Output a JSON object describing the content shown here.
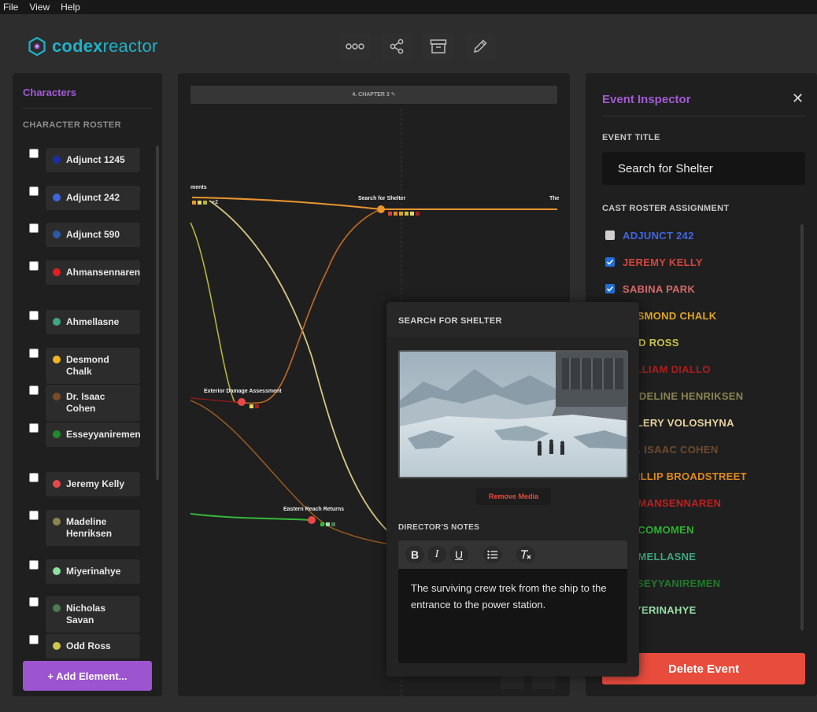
{
  "menu": [
    "File",
    "View",
    "Help"
  ],
  "app": {
    "logo_bold": "codex",
    "logo_light": "reactor"
  },
  "toolbar": [
    {
      "name": "graph-nodes-icon"
    },
    {
      "name": "share-icon"
    },
    {
      "name": "archive-icon"
    },
    {
      "name": "pencil-icon"
    }
  ],
  "left": {
    "title": "Characters",
    "roster_heading": "CHARACTER ROSTER",
    "add_label": "+ Add Element...",
    "items": [
      {
        "label": "Adjunct 1245",
        "color": "#1a2fa5"
      },
      {
        "label": "Adjunct 242",
        "color": "#3e66e0"
      },
      {
        "label": "Adjunct 590",
        "color": "#2b5aa6"
      },
      {
        "label": "Ahmansennaren",
        "color": "#e41f1f"
      },
      {
        "label": "Ahmellasne",
        "color": "#3ea780"
      },
      {
        "label": "Desmond Chalk",
        "color": "#f0b51e"
      },
      {
        "label": "Dr. Isaac Cohen",
        "color": "#7a4a26"
      },
      {
        "label": "Esseyyaniremen",
        "color": "#1f8a2e"
      },
      {
        "label": "Jeremy Kelly",
        "color": "#e44848"
      },
      {
        "label": "Madeline Henriksen",
        "color": "#8a8450"
      },
      {
        "label": "Miyerinahye",
        "color": "#8ce0a0"
      },
      {
        "label": "Nicholas Savan",
        "color": "#4a7a56"
      },
      {
        "label": "Odd Ross",
        "color": "#d0c44a"
      }
    ]
  },
  "timeline": {
    "chapter": "4. CHAPTER 3 ✎",
    "events": {
      "e1": "ments",
      "e1_more": "+2",
      "e2": "Search for Shelter",
      "e3": "The",
      "e4": "Exterior Damage Assessment",
      "e5": "Eastern Reach Returns"
    }
  },
  "inspector": {
    "title": "Event Inspector",
    "close": "✕",
    "event_title_label": "EVENT TITLE",
    "event_title_value": "Search for Shelter",
    "cast_label": "CAST ROSTER ASSIGNMENT",
    "cast": [
      {
        "name": "ADJUNCT 242",
        "color": "#3e66e0",
        "checked": false
      },
      {
        "name": "JEREMY KELLY",
        "color": "#d2463f",
        "checked": true
      },
      {
        "name": "SABINA PARK",
        "color": "#d46a6a",
        "checked": true
      },
      {
        "name": "DESMOND CHALK",
        "color": "#e0a61e",
        "checked": false
      },
      {
        "name": "ODD ROSS",
        "color": "#c8c448",
        "checked": false
      },
      {
        "name": "WILLIAM DIALLO",
        "color": "#a81e1e",
        "checked": false
      },
      {
        "name": "MADELINE HENRIKSEN",
        "color": "#8a8450",
        "checked": false
      },
      {
        "name": "VALERY VOLOSHYNA",
        "color": "#e8d39e",
        "checked": false
      },
      {
        "name": "DR. ISAAC COHEN",
        "color": "#6f4a2e",
        "checked": false
      },
      {
        "name": "PHILLIP BROADSTREET",
        "color": "#e08a1e",
        "checked": false
      },
      {
        "name": "AHMANSENNAREN",
        "color": "#c02020",
        "checked": false
      },
      {
        "name": "ACCOMOMEN",
        "color": "#2fb02f",
        "checked": false
      },
      {
        "name": "AHMELLASNE",
        "color": "#3ea780",
        "checked": false
      },
      {
        "name": "ESSEYYANIREMEN",
        "color": "#1f7a2a",
        "checked": false
      },
      {
        "name": "MIYERINAHYE",
        "color": "#9ae0a8",
        "checked": false
      }
    ],
    "delete_label": "Delete Event"
  },
  "popup": {
    "title": "SEARCH FOR SHELTER",
    "remove_media": "Remove Media",
    "notes_label": "DIRECTOR'S NOTES",
    "notes_text": "The surviving crew trek from the ship to the entrance to the power station.",
    "editor_tools": [
      "bold-icon",
      "italic-icon",
      "underline-icon",
      "bullet-list-icon",
      "clear-format-icon"
    ]
  }
}
